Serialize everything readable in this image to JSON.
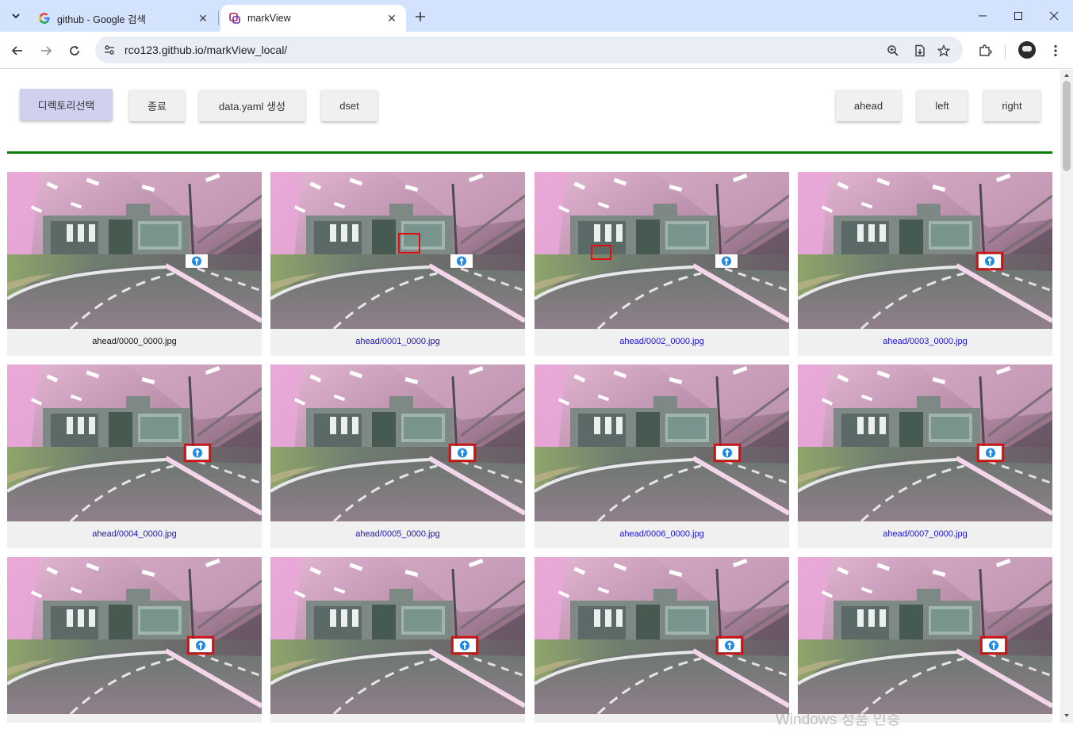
{
  "browser": {
    "tabs": [
      {
        "title": "github - Google 검색",
        "active": false,
        "favicon": "google-icon"
      },
      {
        "title": "markView",
        "active": true,
        "favicon": "markview-icon"
      }
    ],
    "url": "rco123.github.io/markView_local/"
  },
  "toolbar": {
    "buttons_left": [
      "디렉토리선택",
      "종료",
      "data.yaml 생성",
      "dset"
    ],
    "buttons_right": [
      "ahead",
      "left",
      "right"
    ]
  },
  "divider_color": "#0b7a0b",
  "images": [
    {
      "filename": "ahead/0000_0000.jpg",
      "selected": true
    },
    {
      "filename": "ahead/0001_0000.jpg",
      "selected": false
    },
    {
      "filename": "ahead/0002_0000.jpg",
      "selected": false
    },
    {
      "filename": "ahead/0003_0000.jpg",
      "selected": false
    },
    {
      "filename": "ahead/0004_0000.jpg",
      "selected": false
    },
    {
      "filename": "ahead/0005_0000.jpg",
      "selected": false
    },
    {
      "filename": "ahead/0006_0000.jpg",
      "selected": false
    },
    {
      "filename": "ahead/0007_0000.jpg",
      "selected": false
    },
    {
      "filename": "",
      "selected": false
    },
    {
      "filename": "",
      "selected": false
    },
    {
      "filename": "",
      "selected": false
    },
    {
      "filename": "",
      "selected": false
    }
  ],
  "watermark": "Windows 정품 인증"
}
